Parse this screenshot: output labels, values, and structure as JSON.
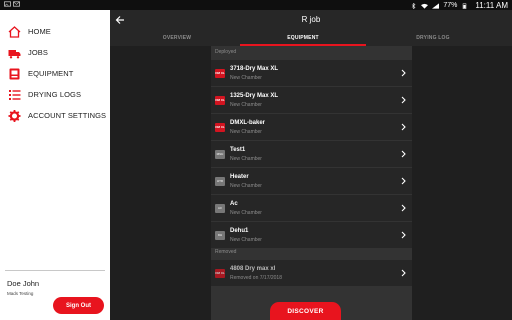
{
  "status_bar": {
    "left_icons": [
      "image-icon",
      "mail-icon"
    ],
    "right_icons": [
      "bluetooth-icon",
      "wifi-icon",
      "signal-icon"
    ],
    "battery": "77%",
    "time": "11:11 AM"
  },
  "drawer": {
    "items": [
      {
        "label": "HOME",
        "icon": "home-icon"
      },
      {
        "label": "JOBS",
        "icon": "truck-icon"
      },
      {
        "label": "EQUIPMENT",
        "icon": "equipment-icon"
      },
      {
        "label": "DRYING LOGS",
        "icon": "list-icon"
      },
      {
        "label": "ACCOUNT SETTINGS",
        "icon": "gear-icon"
      }
    ],
    "user_name": "Doe John",
    "user_sub": "Mads Testing",
    "sign_out_label": "Sign Out"
  },
  "header": {
    "title": "R job",
    "back_icon": "back-arrow-icon"
  },
  "tabs": [
    {
      "label": "OVERVIEW",
      "active": false
    },
    {
      "label": "EQUIPMENT",
      "active": true
    },
    {
      "label": "DRYING LOG",
      "active": false
    }
  ],
  "equipment": {
    "deployed_label": "Deployed",
    "deployed": [
      {
        "name": "3718-Dry Max XL",
        "sub": "New Chamber",
        "thumb": "red",
        "thumb_text": "DM XL"
      },
      {
        "name": "1325-Dry Max XL",
        "sub": "New Chamber",
        "thumb": "red",
        "thumb_text": "DM XL"
      },
      {
        "name": "DMXL-baker",
        "sub": "New Chamber",
        "thumb": "red",
        "thumb_text": "DM XL"
      },
      {
        "name": "Test1",
        "sub": "New Chamber",
        "thumb": "gray",
        "thumb_text": "MSH"
      },
      {
        "name": "Heater",
        "sub": "New Chamber",
        "thumb": "gray",
        "thumb_text": "HTR"
      },
      {
        "name": "Ac",
        "sub": "New Chamber",
        "thumb": "gray",
        "thumb_text": "AC"
      },
      {
        "name": "Dehu1",
        "sub": "New Chamber",
        "thumb": "gray",
        "thumb_text": "DH"
      }
    ],
    "removed_label": "Removed",
    "removed": [
      {
        "name": "4808 Dry max xl",
        "sub": "Removed on 7/17/2018",
        "thumb": "red",
        "thumb_text": "DM XL"
      }
    ]
  },
  "discover_label": "DISCOVER",
  "colors": {
    "accent": "#e8141e",
    "panel": "#333333",
    "row": "#262626",
    "toolbar": "#272727"
  }
}
